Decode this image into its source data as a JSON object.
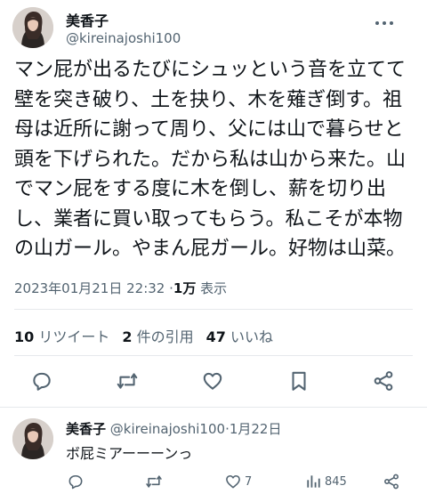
{
  "post": {
    "author_name": "美香子",
    "author_handle": "@kireinajoshi100",
    "body_lines": [
      "マン屁が出るたびにシュッという音を立てて",
      "壁を突き破り、土を抉り、木を薙ぎ倒す。祖",
      "母は近所に謝って周り、父には山で暮らせと",
      "頭を下げられた。だから私は山から来た。山",
      "でマン屁をする度に木を倒し、薪を切り出",
      "し、業者に買い取ってもらう。私こそが本物",
      "の山ガール。やまん屁ガール。好物は山菜。"
    ],
    "timestamp": "2023年01月21日 22:32",
    "separator": "·",
    "views_count": "1万",
    "views_label": "表示"
  },
  "stats": {
    "retweets_count": "10",
    "retweets_label": "リツイート",
    "quotes_count": "2",
    "quotes_label": "件の引用",
    "likes_count": "47",
    "likes_label": "いいね"
  },
  "actions": {
    "icons": [
      "reply-icon",
      "retweet-icon",
      "like-icon",
      "bookmark-icon",
      "share-icon"
    ]
  },
  "reply": {
    "author_name": "美香子",
    "author_handle": "@kireinajoshi100",
    "separator": "·",
    "date": "1月22日",
    "text": "ボ屁ミアーーーンっ",
    "likes_count": "7",
    "views_count": "845"
  },
  "colors": {
    "text_primary": "#0f1419",
    "text_secondary": "#536471",
    "divider": "#e6e9ec",
    "background": "#ffffff"
  }
}
